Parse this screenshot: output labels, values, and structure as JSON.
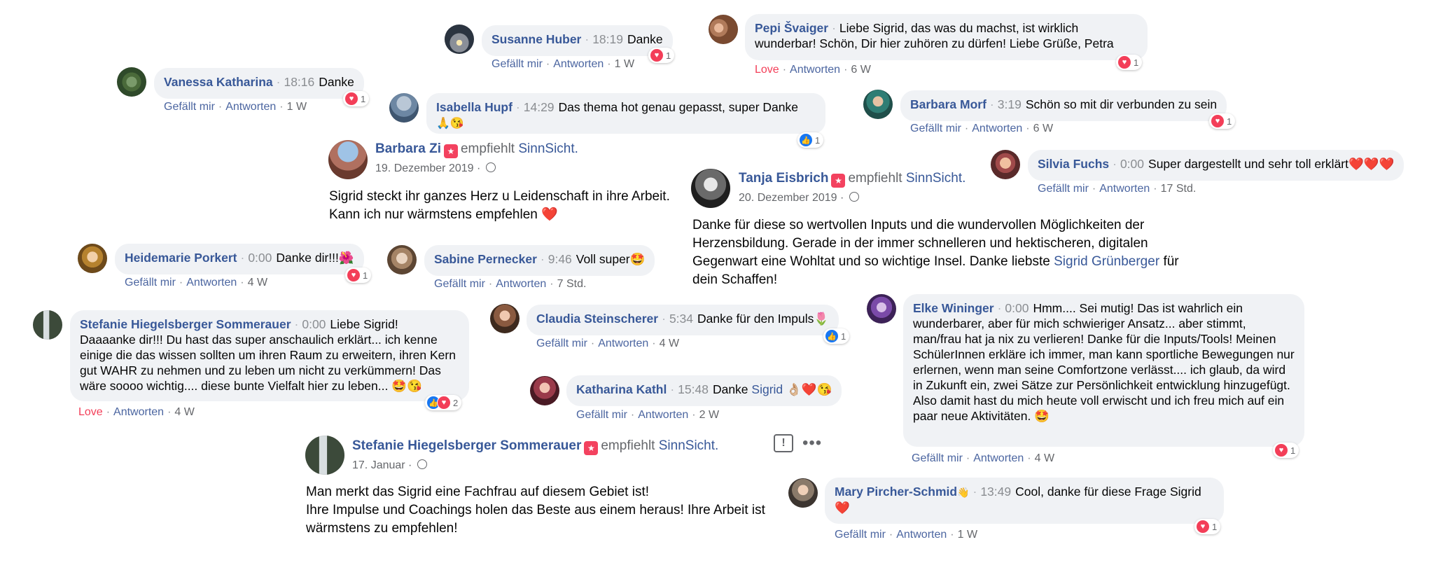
{
  "colors": {
    "name": "#385898",
    "bubble": "#f0f2f5",
    "love": "#f33e58",
    "like": "#1877f2",
    "meta": "#4b65a0"
  },
  "actions": {
    "like": "Gefällt mir",
    "love": "Love",
    "reply": "Antworten"
  },
  "c_susanne": {
    "name": "Susanne Huber",
    "time": "18:19",
    "text": "Danke",
    "age": "1 W",
    "react_count": "1"
  },
  "c_pepi": {
    "name": "Pepi Švaiger",
    "text": "Liebe Sigrid, das was du machst, ist wirklich wunderbar! Schön, Dir hier zuhören zu dürfen! Liebe Grüße, Petra",
    "age": "6 W",
    "react_count": "1"
  },
  "c_vanessa": {
    "name": "Vanessa Katharina",
    "time": "18:16",
    "text": "Danke",
    "age": "1 W",
    "react_count": "1"
  },
  "c_isabella": {
    "name": "Isabella Hupf",
    "time": "14:29",
    "text": "Das thema hot genau gepasst, super Danke",
    "emoji": "🙏😘",
    "react_count": "1"
  },
  "c_barbara_m": {
    "name": "Barbara Morf",
    "time": "3:19",
    "text": "Schön so mit dir verbunden zu sein",
    "age": "6 W",
    "react_count": "1"
  },
  "rec_barbara_zi": {
    "name": "Barbara Zi",
    "recommends": "empfiehlt",
    "page": "SinnSicht.",
    "date": "19. Dezember 2019",
    "body1": "Sigrid steckt ihr ganzes Herz u Leidenschaft in ihre Arbeit.",
    "body2": "Kann ich nur wärmstens empfehlen ❤️"
  },
  "c_silvia": {
    "name": "Silvia Fuchs",
    "time": "0:00",
    "text": "Super dargestellt und sehr toll erklärt❤️❤️❤️",
    "age": "17 Std."
  },
  "rec_tanja": {
    "name": "Tanja Eisbrich",
    "recommends": "empfiehlt",
    "page": "SinnSicht.",
    "date": "20. Dezember 2019",
    "body1": "Danke für diese so wertvollen Inputs und die wundervollen Möglichkeiten der",
    "body2": "Herzensbildung. Gerade in der immer schnelleren und hektischeren, digitalen",
    "body3a": "Gegenwart eine Wohltat und so wichtige Insel. Danke liebste",
    "body3link": "Sigrid Grünberger",
    "body3b": "für",
    "body4": "dein Schaffen!"
  },
  "c_heidemarie": {
    "name": "Heidemarie Porkert",
    "time": "0:00",
    "text": "Danke dir!!!🌺",
    "age": "4 W",
    "react_count": "1"
  },
  "c_sabine": {
    "name": "Sabine Pernecker",
    "time": "9:46",
    "text": "Voll super🤩",
    "age": "7 Std."
  },
  "c_stefanie1": {
    "name": "Stefanie Hiegelsberger Sommerauer",
    "time": "0:00",
    "text_first": "Liebe Sigrid!",
    "text_rest": "Daaaanke dir!!! Du hast das super anschaulich erklärt... ich kenne einige die das wissen sollten um ihren Raum zu erweitern, ihren Kern gut WAHR zu nehmen und zu leben um nicht zu verkümmern! Das wäre soooo wichtig.... diese bunte Vielfalt hier zu leben... 🤩😘",
    "age": "4 W",
    "react_count": "2"
  },
  "c_claudia": {
    "name": "Claudia Steinscherer",
    "time": "5:34",
    "text": "Danke für den Impuls🌷",
    "age": "4 W",
    "react_count": "1"
  },
  "c_elke": {
    "name": "Elke Wininger",
    "time": "0:00",
    "text_first": "Hmm.... Sei mutig! Das ist wahrlich ein",
    "text_rest": "wunderbarer, aber für mich schwieriger Ansatz... aber stimmt, man/frau hat ja nix zu verlieren! Danke für die Inputs/Tools! Meinen SchülerInnen erkläre ich immer, man kann sportliche Bewegungen nur erlernen, wenn man seine Comfortzone verlässt.... ich glaub, da wird in Zukunft ein, zwei Sätze zur Persönlichkeit entwicklung hinzugefügt.",
    "text_extra": "Also damit hast du mich heute voll erwischt und ich freu mich auf ein paar neue Aktivitäten. 🤩",
    "age": "4 W",
    "react_count": "1"
  },
  "c_katharina": {
    "name": "Katharina Kathl",
    "time": "15:48",
    "text": "Danke",
    "link": "Sigrid",
    "emoji": "👌🏼❤️😘",
    "age": "2 W"
  },
  "rec_stefanie": {
    "name": "Stefanie Hiegelsberger Sommerauer",
    "recommends": "empfiehlt",
    "page": "SinnSicht.",
    "date": "17. Januar",
    "body1": "Man merkt das Sigrid eine Fachfrau auf diesem Gebiet ist!",
    "body2": "Ihre Impulse und Coachings holen das Beste aus einem heraus! Ihre Arbeit ist",
    "body3": "wärmstens zu empfehlen!"
  },
  "c_mary": {
    "name": "Mary Pircher-Schmid",
    "badge": "👋",
    "time": "13:49",
    "text": "Cool, danke für diese Frage Sigrid ❤️",
    "age": "1 W",
    "react_count": "1"
  }
}
